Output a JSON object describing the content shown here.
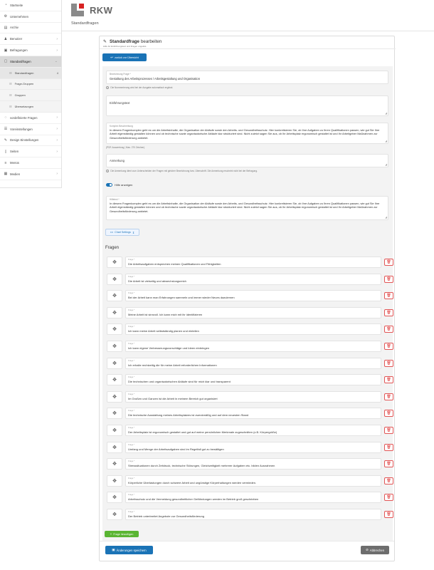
{
  "app": {
    "logo_text": "RKW",
    "page_subtitle": "Standardfragen"
  },
  "sidebar": {
    "items": [
      {
        "label": "Startseite",
        "icon": "dashboard-icon",
        "chevron": false
      },
      {
        "label": "Unternehmen",
        "icon": "gear-icon",
        "chevron": false
      },
      {
        "label": "Archiv",
        "icon": "archive-icon",
        "chevron": false
      },
      {
        "label": "Benutzer",
        "icon": "user-icon",
        "chevron": true
      },
      {
        "label": "Befragungen",
        "icon": "survey-icon",
        "chevron": true
      },
      {
        "label": "Standardfragen",
        "icon": "folder-icon",
        "chevron": true,
        "active": true
      }
    ],
    "sub_items": [
      {
        "label": "Standardfragen",
        "count": "4",
        "active": true
      },
      {
        "label": "Frage-Gruppen",
        "count": ""
      },
      {
        "label": "Gruppen",
        "count": ""
      },
      {
        "label": "Übersetzungen",
        "count": ""
      }
    ],
    "items_after": [
      {
        "label": "vordefinierte Fragen",
        "icon": "question-icon",
        "chevron": true
      },
      {
        "label": "Voreinstellungen",
        "icon": "sliders-icon",
        "chevron": true
      },
      {
        "label": "Design Einstellungen",
        "icon": "palette-icon",
        "chevron": true
      },
      {
        "label": "Seiten",
        "icon": "page-icon",
        "chevron": true
      },
      {
        "label": "Menüs",
        "icon": "menu-icon",
        "chevron": false
      },
      {
        "label": "Medien",
        "icon": "media-icon",
        "chevron": true
      }
    ]
  },
  "card": {
    "title_bold": "Standardfrage",
    "title_rest": "bearbeiten",
    "hint": "Hilfe für Einführungstext und Fragen ungelöst.",
    "back_button": "zurück zur Übersicht"
  },
  "form": {
    "bezeichnung_label": "Bezeichnung Frage *",
    "bezeichnung_value": "Gestaltung des Arbeitsprozesses / Arbeitsgestaltung und Organisation",
    "bezeichnung_hint": "Die Nummerierung wird bei der Ausgabe automatisch ergänzt.",
    "einfuehrung_placeholder": "Einführungstext",
    "komplex_label": "Komplex Beschreibung",
    "komplex_value": "In diesem Fragenkomplex geht es um die Arbeitsinhalte, die Organisation der Abläufe sowie den Arbeits- und Gesundheitsschutz. Hier konkretisieren Sie, ob Ihre Aufgaben zu Ihren Qualifikationen passen, wie gut Sie Ihre Arbeit eigenständig gestalten können und ob technische sowie organisatorische Abläufe klar strukturiert sind. Nicht zuletzt sagen Sie aus, ob Ihr Arbeitsplatz ergonomisch gestaltet ist und Ihr Arbeitgeber Maßnahmen zur Gesundheitsförderung anbietet.",
    "komplex_note": "(PDF-Auswertung | Max. 270 Zeichen)",
    "anmerkung_placeholder": "Anmerkung",
    "anmerkung_hint": "Die Anmerkung dient zum Unterscheiden der Fragen mit gleicher Bezeichnung bzw. Überschrift. Die Anmerkung erscheint nicht bei der Befragung.",
    "hilfe_label": "Hilfe anzeigen",
    "hilfe_enabled": true,
    "hilfetext_label": "Hilfetext *",
    "hilfetext_value": "In diesem Fragenkomplex geht es um die Arbeitsinhalte, die Organisation der Abläufe sowie den Arbeits- und Gesundheitsschutz. Hier konkretisieren Sie, ob Ihre Aufgaben zu Ihren Qualifikationen passen, wie gut Sie Ihre Arbeit eigenständig gestalten können und ob technische sowie organisatorische Abläufe klar strukturiert sind. Nicht zuletzt sagen Sie aus, ob Ihr Arbeitsplatz ergonomisch gestaltet ist und Ihr Arbeitgeber Maßnahmen zur Gesundheitsförderung anbietet.",
    "chart_settings": "Chart Settings"
  },
  "fragen": {
    "title": "Fragen",
    "label": "Frage *",
    "items": [
      "Die Arbeitsaufgaben entsprechen meinen Qualifikationen und Fähigkeiten",
      "Die Arbeit ist vielseitig und abwechslungsreich",
      "Bei der Arbeit kann man Erfahrungen sammeln und immer wieder Neues dazulernen",
      "Meine Arbeit ist sinnvoll. Ich kann mich mit ihr identifizieren",
      "Ich kann meine Arbeit selbstständig planen und einteilen",
      "Ich kann eigene Verbesserungsvorschläge und Ideen einbringen",
      "Ich erhalte rechtzeitig die für meine Arbeit erforderlichen Informationen",
      "Die technischen und organisatorischen Abläufe sind für mich klar und transparent",
      "Im Großen und Ganzen ist die Arbeit in meinem Bereich gut organisiert",
      "Die technische Ausstattung meines Arbeitsplatzes ist zweckmäßig und auf dem neuesten Stand",
      "Der Arbeitsplatz ist ergonomisch gestaltet und gut auf meine persönlichen Merkmale zugeschnitten (z.B. Körpergröße)",
      "Umfang und Menge der Arbeitsaufgaben sind im Regelfall gut zu bewältigen",
      "Stresssituationen durch Zeitdruck, technische Störungen, Gleichzeitigkeit mehrerer Aufgaben etc. bilden Ausnahmen",
      "Körperliche Überlastungen durch schwere Arbeit und ungünstige Körperhaltungen werden vermieden.",
      "Arbeitsschutz und die Vermeidung gesundheitlicher Gefährdungen werden im Betrieb groß geschrieben",
      "Der Betrieb unterbreitet Angebote zur Gesundheitsförderung"
    ],
    "add_button": "Frage hinzufügen"
  },
  "footer": {
    "save_button": "Änderungen speichern",
    "cancel_button": "Abbrechen"
  }
}
